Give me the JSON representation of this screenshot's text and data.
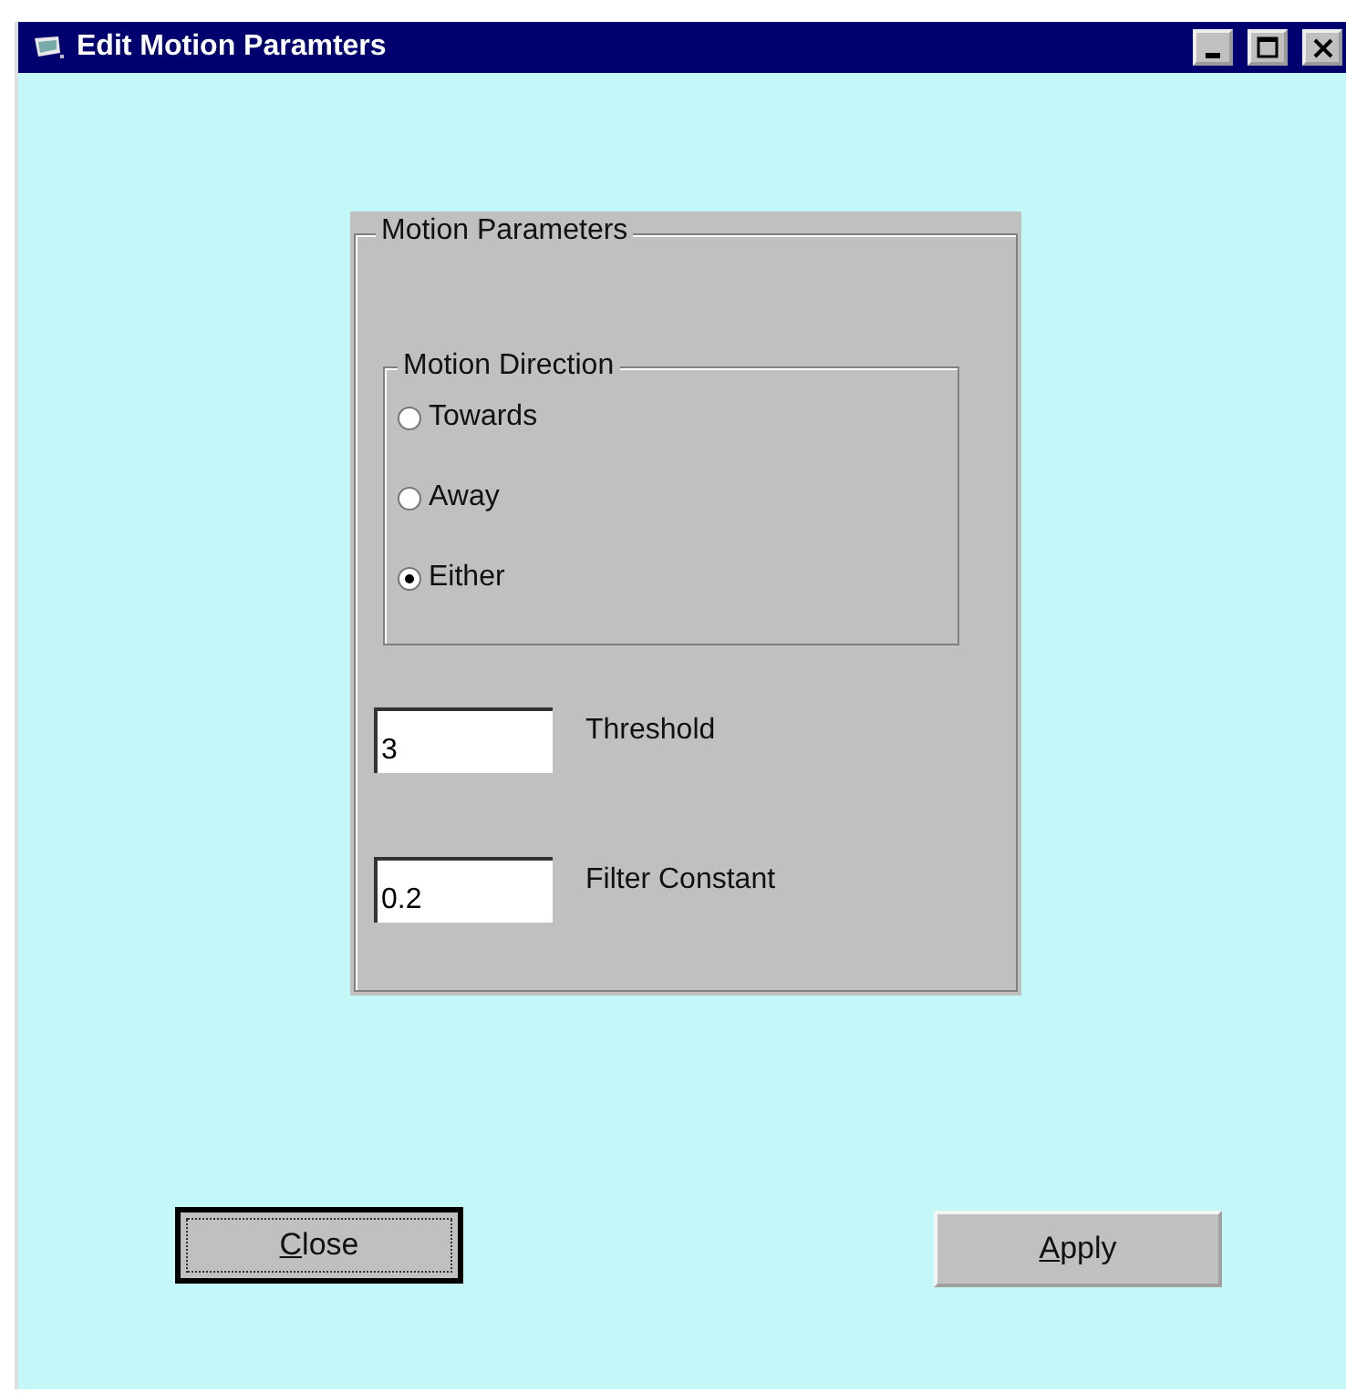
{
  "window": {
    "title": "Edit Motion Paramters",
    "controls": [
      {
        "kind": "minimize"
      },
      {
        "kind": "maximize"
      },
      {
        "kind": "close"
      }
    ]
  },
  "parameters": {
    "title": "Motion Parameters",
    "direction": {
      "title": "Motion Direction",
      "options": [
        {
          "label": "Towards",
          "selected": false
        },
        {
          "label": "Away",
          "selected": false
        },
        {
          "label": "Either",
          "selected": true
        }
      ]
    },
    "fields": [
      {
        "label": "Threshold",
        "value": "3"
      },
      {
        "label": "Filter Constant",
        "value": "0.2"
      }
    ]
  },
  "buttons": [
    {
      "label": "Close",
      "default": true,
      "mnemonic_first": true
    },
    {
      "label": "Apply",
      "default": false,
      "mnemonic_first": true
    }
  ]
}
